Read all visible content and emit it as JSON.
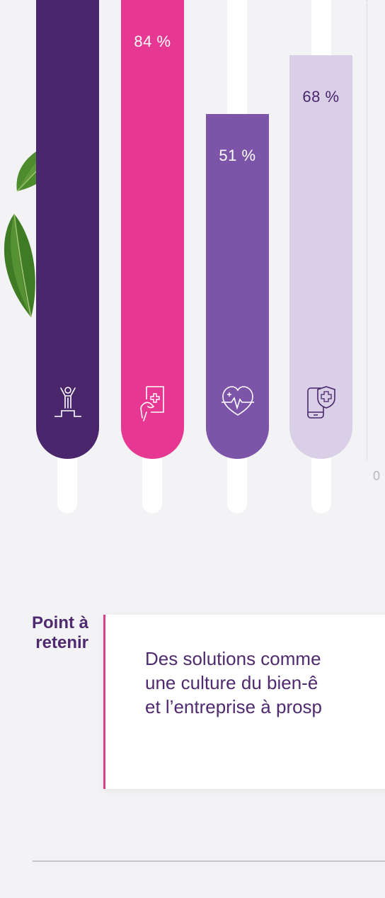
{
  "chart_data": {
    "type": "bar",
    "categories": [
      "",
      "84 %",
      "51 %",
      "68 %"
    ],
    "values": [
      100,
      84,
      51,
      68
    ],
    "value_labels": [
      "",
      "84 %",
      "51 %",
      "68 %"
    ],
    "bar_colors": [
      "#4a266c",
      "#e63893",
      "#7c55a8",
      "#d9cfe6"
    ],
    "label_colors": [
      "#ffffff",
      "#ffffff",
      "#ffffff",
      "#4a266c"
    ],
    "icon_colors": [
      "#ffffff",
      "#ffffff",
      "#ffffff",
      "#4a266c"
    ],
    "icons": [
      "person-podium-icon",
      "medical-document-hand-icon",
      "heart-pulse-icon",
      "phone-shield-cross-icon"
    ],
    "ylim": [
      0,
      100
    ],
    "y_tick_labels": [
      "0"
    ]
  },
  "takeaway": {
    "title_line1": "Point à",
    "title_line2": "retenir",
    "text_line1": "Des solutions comme",
    "text_line2": "une culture du bien-ê",
    "text_line3": "et l’entreprise à prosp"
  }
}
